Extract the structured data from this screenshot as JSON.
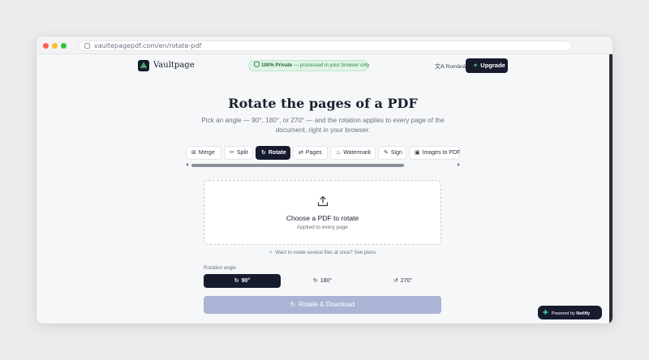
{
  "browser": {
    "url": "vaultepagepdf.com/en/rotate-pdf"
  },
  "header": {
    "brand": "Vaultpage",
    "privacy_strong": "100% Private",
    "privacy_rest": " — processed in your browser only",
    "language": "Română",
    "upgrade_label": "Upgrade"
  },
  "main": {
    "title": "Rotate the pages of a PDF",
    "subtitle": "Pick an angle — 90°, 180°, or 270° — and the rotation applies to every page of the document, right in your browser."
  },
  "tools": [
    {
      "label": "Merge",
      "icon": "merge-icon",
      "glyph": "⊞",
      "active": false
    },
    {
      "label": "Split",
      "icon": "scissors-icon",
      "glyph": "✂",
      "active": false
    },
    {
      "label": "Rotate",
      "icon": "rotate-icon",
      "glyph": "↻",
      "active": true
    },
    {
      "label": "Pages",
      "icon": "pages-icon",
      "glyph": "⇄",
      "active": false
    },
    {
      "label": "Watermark",
      "icon": "watermark-icon",
      "glyph": "♨",
      "active": false
    },
    {
      "label": "Sign",
      "icon": "pen-icon",
      "glyph": "✎",
      "active": false
    },
    {
      "label": "Images to PDF",
      "icon": "image-icon",
      "glyph": "▣",
      "active": false
    }
  ],
  "dropzone": {
    "title": "Choose a PDF to rotate",
    "subtitle": "Applied to every page"
  },
  "hint": "Want to rotate several files at once? See plans.",
  "rotation": {
    "label": "Rotation angle",
    "options": [
      {
        "label": "90°",
        "icon": "rotate-cw-icon",
        "selected": true
      },
      {
        "label": "180°",
        "icon": "rotate-cw-icon",
        "selected": false
      },
      {
        "label": "270°",
        "icon": "rotate-ccw-icon",
        "selected": false
      }
    ]
  },
  "action": {
    "label": "Rotate & Download"
  },
  "badge": {
    "prefix": "Powered by ",
    "brand": "Netlify"
  },
  "colors": {
    "dark": "#161b2e",
    "accent_green": "#4ad07d",
    "private_bg": "#dff3e6",
    "disabled_button": "#aab5d5"
  }
}
